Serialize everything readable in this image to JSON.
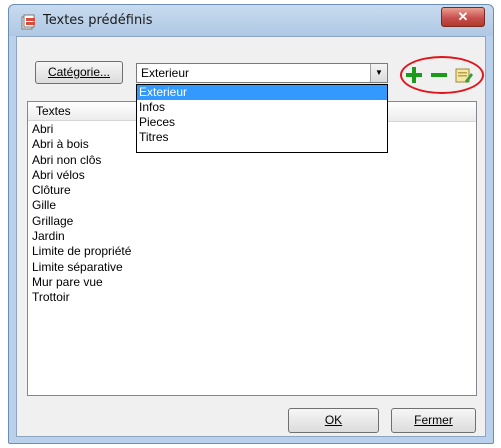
{
  "window": {
    "title": "Textes prédéfinis",
    "close_glyph": "✕"
  },
  "toolbar": {
    "category_button_label": "Catégorie...",
    "combo_value": "Exterieur",
    "add_icon": "plus-icon",
    "remove_icon": "minus-icon",
    "edit_icon": "edit-icon",
    "add_color": "#1a9c1a",
    "remove_color": "#1a9c1a"
  },
  "dropdown": {
    "options": [
      "Exterieur",
      "Infos",
      "Pieces",
      "Titres"
    ],
    "selected_index": 0,
    "selection_color": "#3399ff"
  },
  "list": {
    "header": "Textes",
    "items": [
      "Abri",
      "Abri à bois",
      "Abri non clôs",
      "Abri vélos",
      "Clôture",
      "Gille",
      "Grillage",
      "Jardin",
      "Limite de propriété",
      "Limite séparative",
      "Mur pare vue",
      "Trottoir"
    ]
  },
  "buttons": {
    "ok_label": "OK",
    "close_label": "Fermer"
  },
  "annotation": {
    "highlight_color": "#e0151b"
  }
}
